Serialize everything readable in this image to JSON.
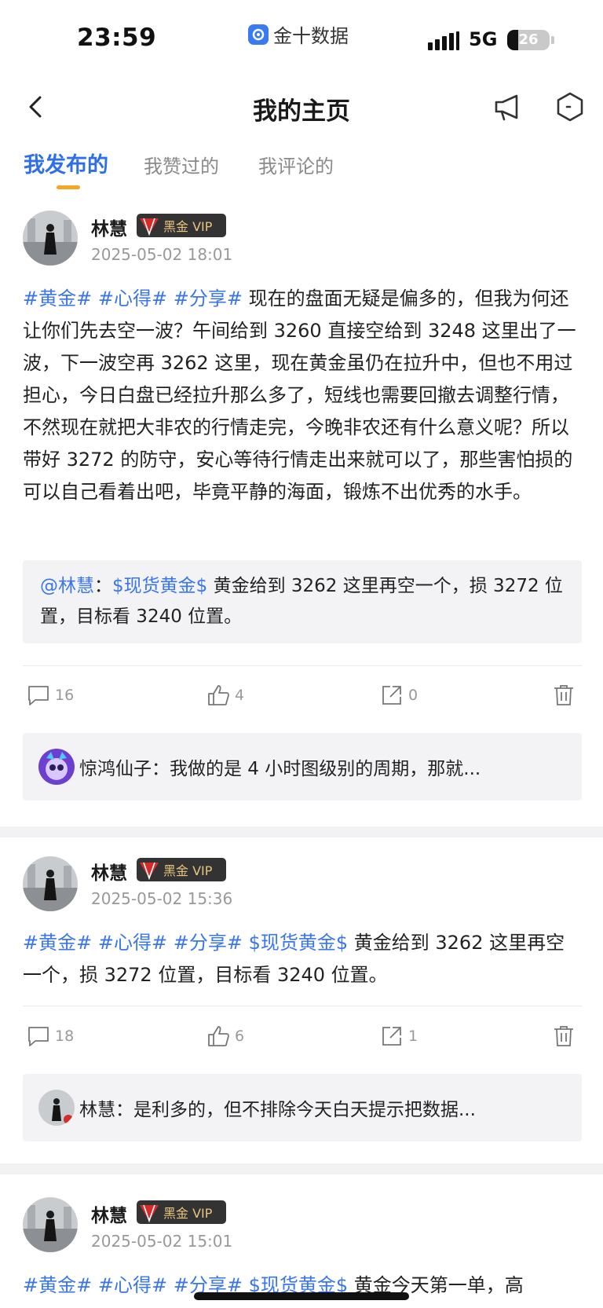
{
  "status": {
    "time": "23:59",
    "app_label": "金十数据",
    "network": "5G",
    "battery": "26",
    "battery_level": 0.26
  },
  "header": {
    "title": "我的主页"
  },
  "tabs": [
    {
      "label": "我发布的",
      "active": true
    },
    {
      "label": "我赞过的",
      "active": false
    },
    {
      "label": "我评论的",
      "active": false
    }
  ],
  "posts": [
    {
      "author": "林慧",
      "vip_label": "黑金 VIP",
      "time": "2025-05-02 18:01",
      "tags": [
        "#黄金#",
        "#心得#",
        "#分享#"
      ],
      "text": "现在的盘面无疑是偏多的，但我为何还让你们先去空一波？午间给到 3260 直接空给到 3248 这里出了一波，下一波空再 3262 这里，现在黄金虽仍在拉升中，但也不用过担心，今日白盘已经拉升那么多了，短线也需要回撤去调整行情，不然现在就把大非农的行情走完，今晚非农还有什么意义呢？所以带好 3272 的防守，安心等待行情走出来就可以了，那些害怕损的可以自己看着出吧，毕竟平静的海面，锻炼不出优秀的水手。",
      "quote": {
        "mention": "@林慧",
        "colon": "：",
        "topic": "$现货黄金$",
        "text": "黄金给到 3262 这里再空一个，损 3272 位置，目标看 3240 位置。"
      },
      "comments": "16",
      "likes": "4",
      "shares": "0",
      "latest_comment": "惊鸿仙子：我做的是 4 小时图级别的周期，那就..."
    },
    {
      "author": "林慧",
      "vip_label": "黑金 VIP",
      "time": "2025-05-02 15:36",
      "tags": [
        "#黄金#",
        "#心得#",
        "#分享#",
        "$现货黄金$"
      ],
      "text": "黄金给到 3262 这里再空一个，损 3272 位置，目标看 3240 位置。",
      "comments": "18",
      "likes": "6",
      "shares": "1",
      "latest_comment": "林慧：是利多的，但不排除今天白天提示把数据..."
    },
    {
      "author": "林慧",
      "vip_label": "黑金 VIP",
      "time": "2025-05-02 15:01",
      "tags": [
        "#黄金#",
        "#心得#",
        "#分享#",
        "$现货黄金$"
      ],
      "text": "黄金今天第一单，高"
    }
  ]
}
